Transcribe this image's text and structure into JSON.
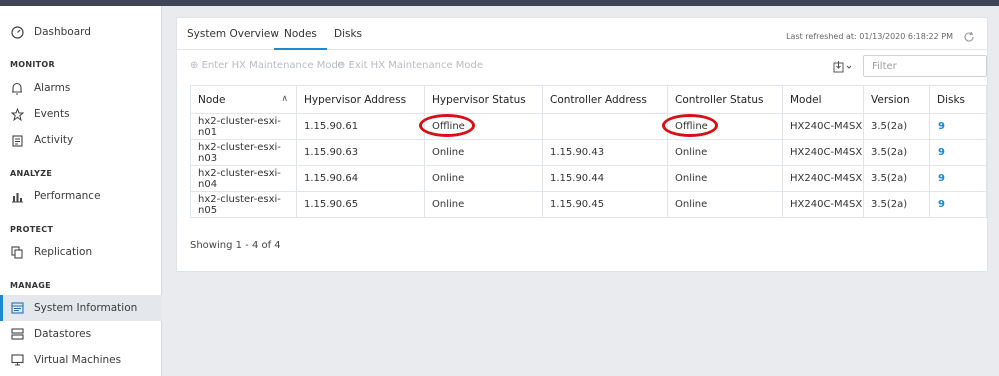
{
  "sidebar": {
    "items": [
      {
        "label": "Dashboard",
        "icon": "dashboard-icon"
      },
      {
        "label": "Alarms",
        "icon": "bell-icon"
      },
      {
        "label": "Events",
        "icon": "star-icon"
      },
      {
        "label": "Activity",
        "icon": "clipboard-icon"
      },
      {
        "label": "Performance",
        "icon": "bar-chart-icon"
      },
      {
        "label": "Replication",
        "icon": "copy-icon"
      },
      {
        "label": "System Information",
        "icon": "system-info-icon"
      },
      {
        "label": "Datastores",
        "icon": "datastore-icon"
      },
      {
        "label": "Virtual Machines",
        "icon": "monitor-icon"
      }
    ],
    "sections": [
      "MONITOR",
      "ANALYZE",
      "PROTECT",
      "MANAGE"
    ]
  },
  "tabs": [
    "System Overview",
    "Nodes",
    "Disks"
  ],
  "refresh_text": "Last refreshed at: 01/13/2020 6:18:22 PM",
  "toolbar": {
    "enter_label": "Enter HX Maintenance Mode",
    "exit_label": "Exit HX Maintenance Mode",
    "filter_placeholder": "Filter"
  },
  "table": {
    "headers": [
      "Node",
      "Hypervisor Address",
      "Hypervisor Status",
      "Controller Address",
      "Controller Status",
      "Model",
      "Version",
      "Disks"
    ],
    "rows": [
      [
        "hx2-cluster-esxi-n01",
        "1.15.90.61",
        "Offline",
        "",
        "Offline",
        "HX240C-M4SX",
        "3.5(2a)",
        "9"
      ],
      [
        "hx2-cluster-esxi-n03",
        "1.15.90.63",
        "Online",
        "1.15.90.43",
        "Online",
        "HX240C-M4SX",
        "3.5(2a)",
        "9"
      ],
      [
        "hx2-cluster-esxi-n04",
        "1.15.90.64",
        "Online",
        "1.15.90.44",
        "Online",
        "HX240C-M4SX",
        "3.5(2a)",
        "9"
      ],
      [
        "hx2-cluster-esxi-n05",
        "1.15.90.65",
        "Online",
        "1.15.90.45",
        "Online",
        "HX240C-M4SX",
        "3.5(2a)",
        "9"
      ]
    ]
  },
  "showing_text": "Showing 1 - 4 of 4",
  "colors": {
    "accent": "#1a8ad4",
    "highlight_ring": "#d90f16",
    "topbar": "#3f4457"
  }
}
